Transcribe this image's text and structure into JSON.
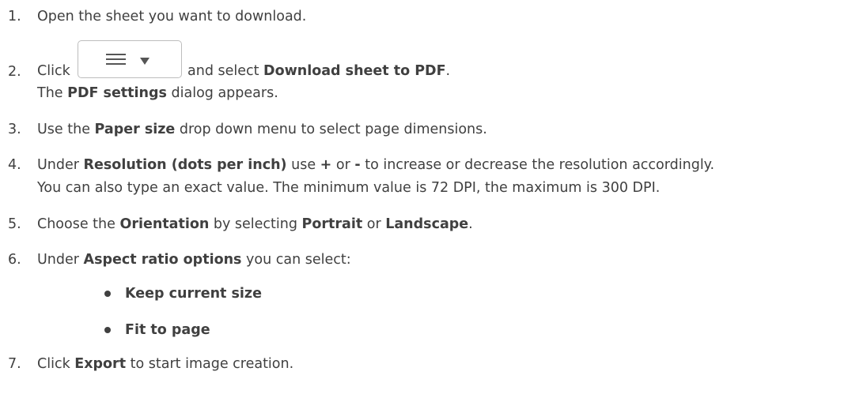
{
  "steps": [
    {
      "number": "1.",
      "text": "Open the sheet you want to download."
    },
    {
      "number": "2.",
      "prefix": "Click",
      "mid": " and select ",
      "bold": "Download sheet to PDF",
      "suffix": ".",
      "line2_prefix": "The ",
      "line2_bold": "PDF settings",
      "line2_suffix": " dialog appears."
    },
    {
      "number": "3.",
      "prefix": "Use the ",
      "bold": "Paper size",
      "suffix": " drop down menu to select page dimensions."
    },
    {
      "number": "4.",
      "prefix": "Under ",
      "bold1": "Resolution (dots per inch)",
      "mid1": " use ",
      "bold2": "+",
      "mid2": " or ",
      "bold3": "-",
      "suffix": " to increase or decrease the resolution accordingly.",
      "line2": "You can also type an exact value. The minimum value is 72 DPI, the maximum is 300 DPI."
    },
    {
      "number": "5.",
      "prefix": "Choose the ",
      "bold1": "Orientation",
      "mid1": " by selecting ",
      "bold2": "Portrait",
      "mid2": " or ",
      "bold3": "Landscape",
      "suffix": "."
    },
    {
      "number": "6.",
      "prefix": "Under ",
      "bold": "Aspect ratio options",
      "suffix": " you can select:",
      "options": [
        "Keep current size",
        "Fit to page"
      ]
    },
    {
      "number": "7.",
      "prefix": "Click ",
      "bold": "Export",
      "suffix": " to start image creation."
    }
  ],
  "icons": {
    "menu_button": "hamburger-menu-icon",
    "menu_caret": "chevron-down-icon"
  }
}
